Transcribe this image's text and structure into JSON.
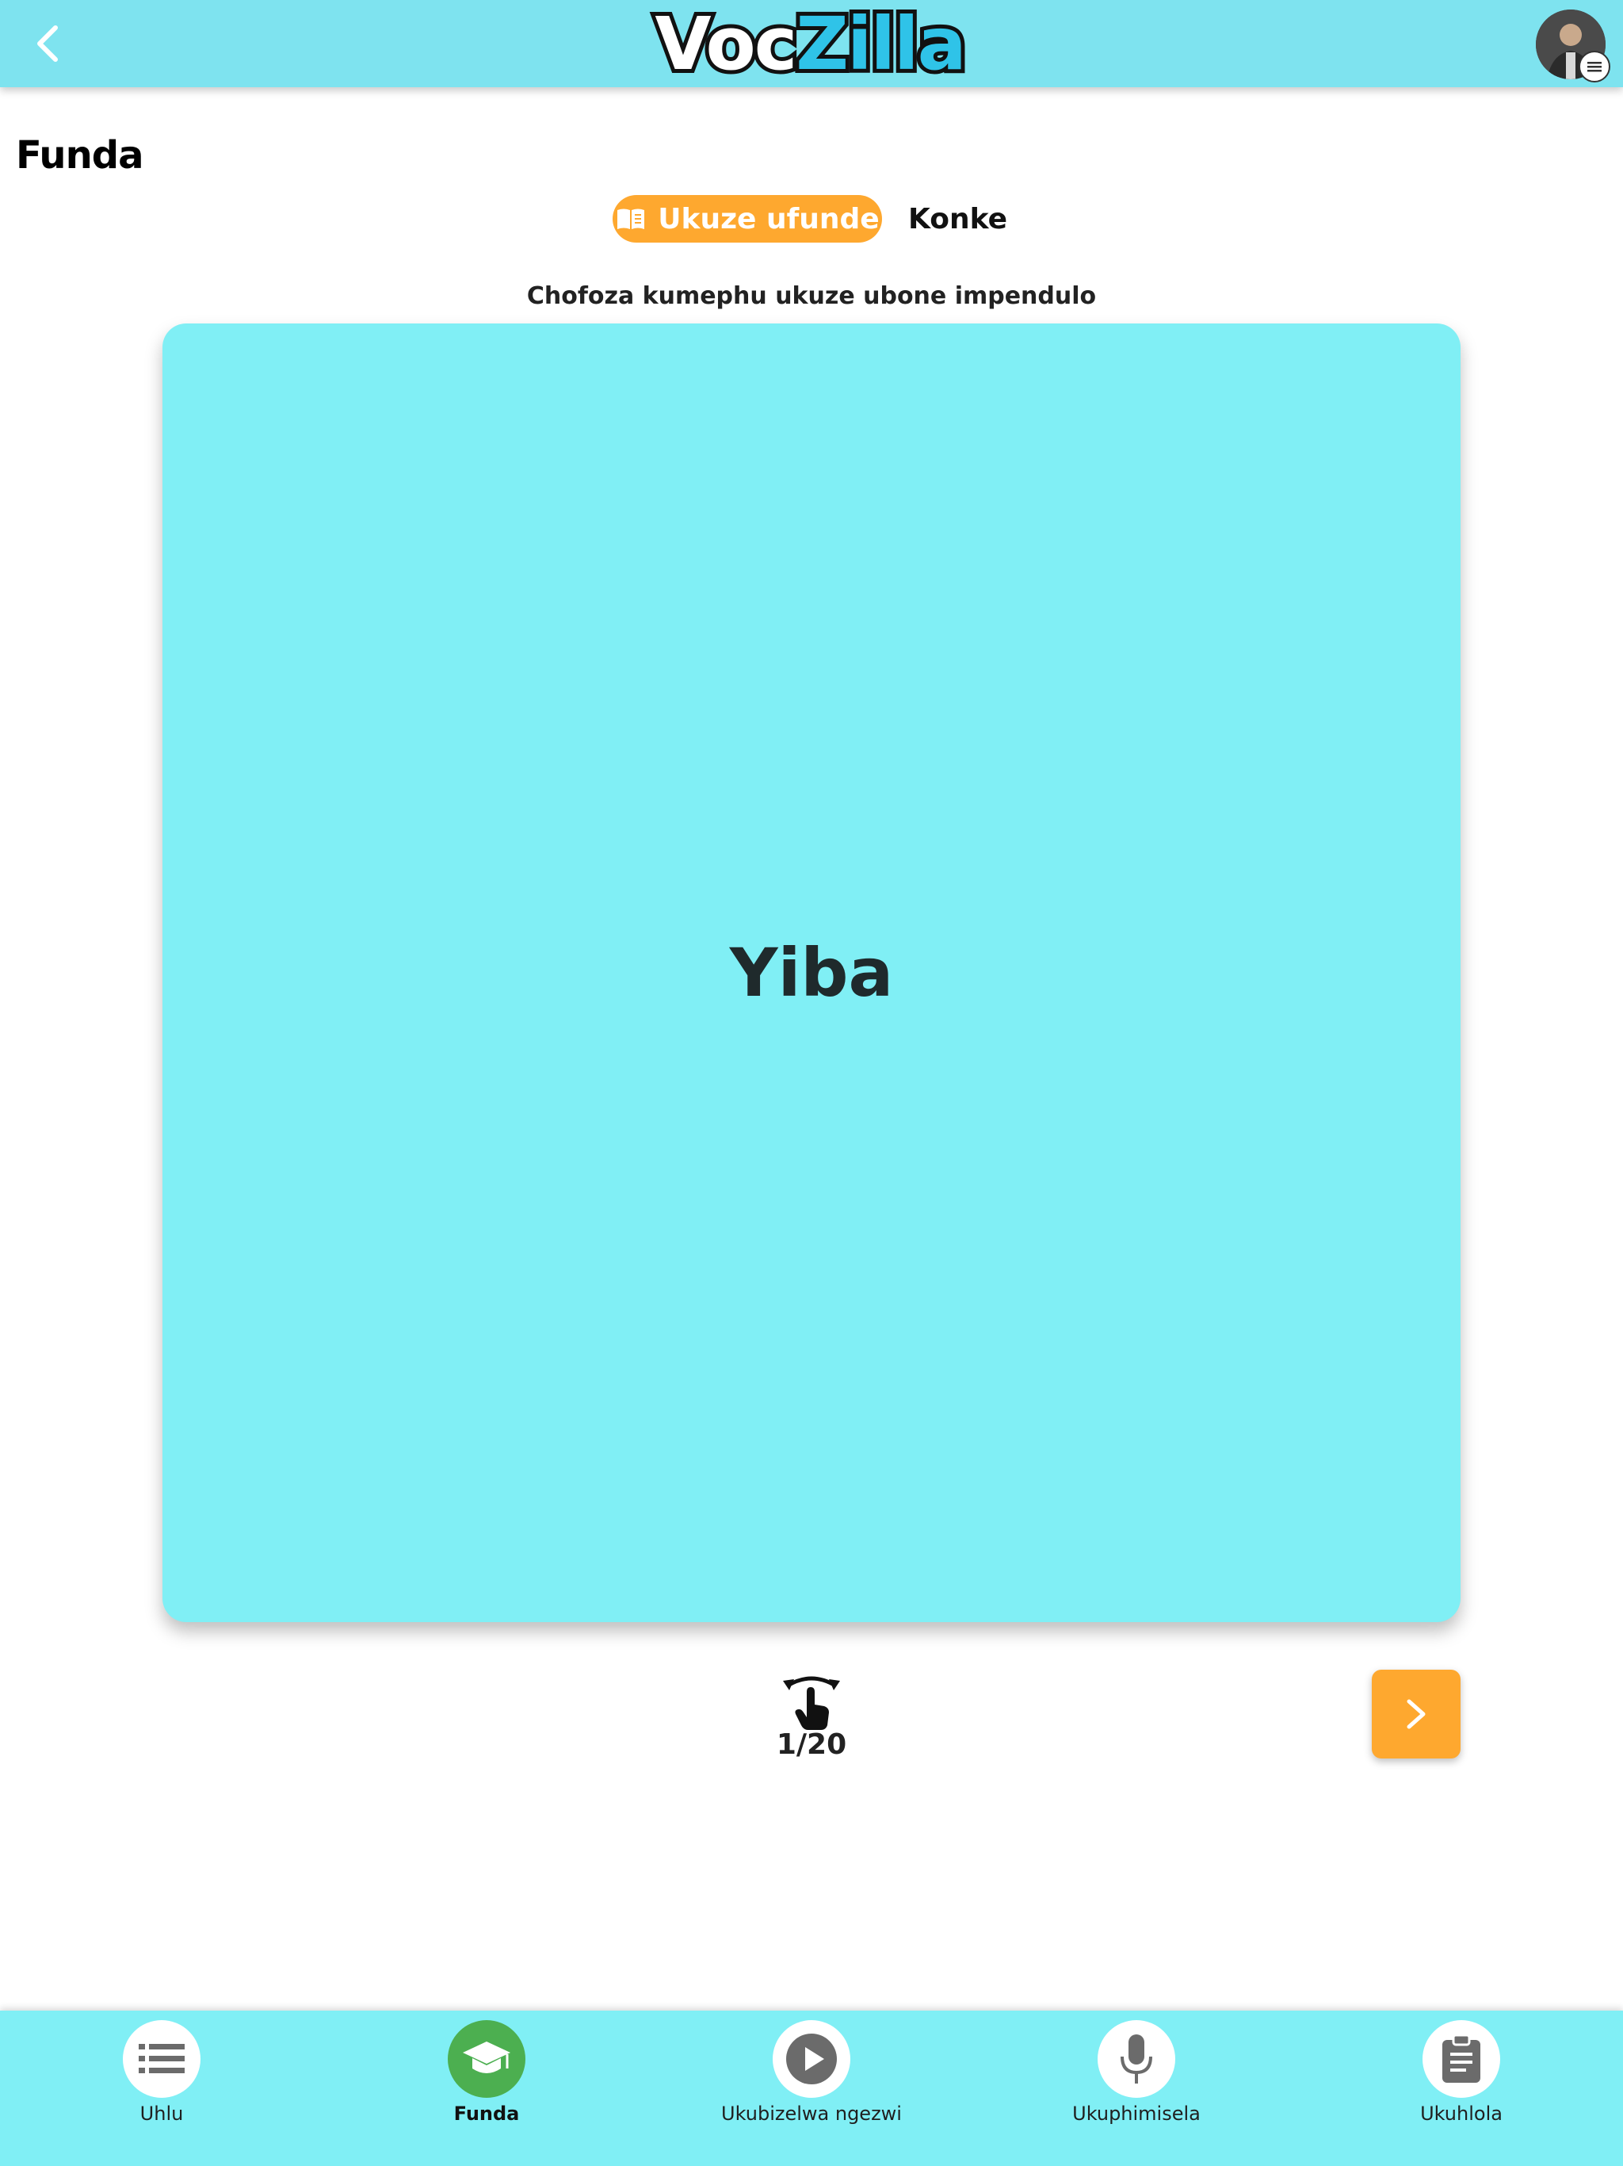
{
  "header": {
    "logo_part1": "Voc",
    "logo_part2": "Zilla",
    "back_icon": "chevron-left-icon",
    "avatar_badge_icon": "menu-icon"
  },
  "page": {
    "title": "Funda"
  },
  "modes": {
    "active_label": "Ukuze ufunde",
    "active_icon": "book-icon",
    "other_label": "Konke"
  },
  "hint": "Chofoza kumephu ukuze ubone impendulo",
  "card": {
    "word": "Yiba"
  },
  "progress": {
    "label": "1/20",
    "current": 1,
    "total": 20
  },
  "nav": {
    "items": [
      {
        "label": "Uhlu",
        "icon": "list-icon",
        "active": false
      },
      {
        "label": "Funda",
        "icon": "graduation-cap-icon",
        "active": true
      },
      {
        "label": "Ukubizelwa ngezwi",
        "icon": "play-icon",
        "active": false
      },
      {
        "label": "Ukuphimisela",
        "icon": "microphone-icon",
        "active": false
      },
      {
        "label": "Ukuhlola",
        "icon": "clipboard-icon",
        "active": false
      }
    ]
  },
  "colors": {
    "header_bg": "#7ee3ef",
    "card_bg": "#80eff5",
    "accent_orange": "#fea82f",
    "active_green": "#4caf50",
    "logo_blue": "#2fc3e8"
  }
}
